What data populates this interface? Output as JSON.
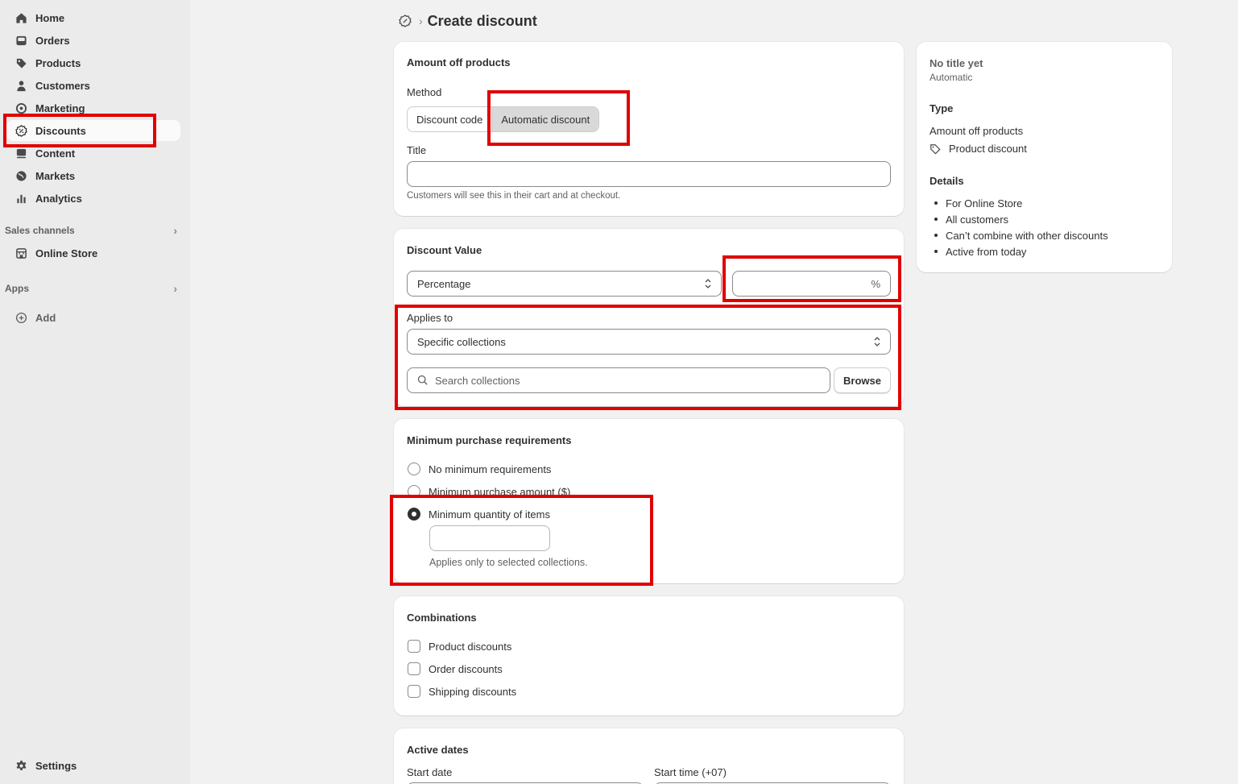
{
  "sidebar": {
    "items": [
      {
        "label": "Home",
        "icon": "home-icon"
      },
      {
        "label": "Orders",
        "icon": "inbox-icon"
      },
      {
        "label": "Products",
        "icon": "tag-icon"
      },
      {
        "label": "Customers",
        "icon": "person-icon"
      },
      {
        "label": "Marketing",
        "icon": "target-icon"
      },
      {
        "label": "Discounts",
        "icon": "discount-icon",
        "active": true
      },
      {
        "label": "Content",
        "icon": "content-icon"
      },
      {
        "label": "Markets",
        "icon": "globe-icon"
      },
      {
        "label": "Analytics",
        "icon": "bar-chart-icon"
      }
    ],
    "sales_channels_title": "Sales channels",
    "online_store_label": "Online Store",
    "apps_title": "Apps",
    "add_label": "Add",
    "settings_label": "Settings"
  },
  "header": {
    "title": "Create discount"
  },
  "amount_card": {
    "title": "Amount off products",
    "method_label": "Method",
    "method_options": [
      "Discount code",
      "Automatic discount"
    ],
    "method_selected": "Automatic discount",
    "title_label": "Title",
    "title_value": "",
    "title_help": "Customers will see this in their cart and at checkout."
  },
  "value_card": {
    "title": "Discount Value",
    "type_value": "Percentage",
    "amount_value": "",
    "amount_suffix": "%",
    "applies_label": "Applies to",
    "applies_value": "Specific collections",
    "search_placeholder": "Search collections",
    "browse_label": "Browse"
  },
  "min_card": {
    "title": "Minimum purchase requirements",
    "options": [
      "No minimum requirements",
      "Minimum purchase amount ($)",
      "Minimum quantity of items"
    ],
    "selected": "Minimum quantity of items",
    "quantity_value": "",
    "help": "Applies only to selected collections."
  },
  "comb_card": {
    "title": "Combinations",
    "options": [
      "Product discounts",
      "Order discounts",
      "Shipping discounts"
    ]
  },
  "dates_card": {
    "title": "Active dates",
    "start_date_label": "Start date",
    "start_time_label": "Start time (+07)"
  },
  "summary": {
    "title": "No title yet",
    "subtitle": "Automatic",
    "type_heading": "Type",
    "type_value": "Amount off products",
    "type_detail": "Product discount",
    "details_heading": "Details",
    "details": [
      "For Online Store",
      "All customers",
      "Can’t combine with other discounts",
      "Active from today"
    ]
  },
  "colors": {
    "highlight": "#e00000",
    "sidebar_bg": "#ebebeb",
    "page_bg": "#f1f1f1"
  }
}
